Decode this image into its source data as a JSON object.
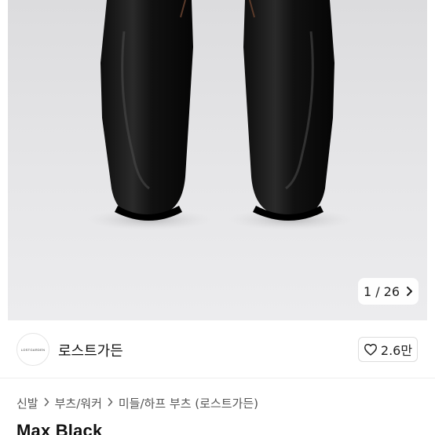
{
  "gallery": {
    "counter": "1 / 26",
    "next_icon": "chevron-right-icon"
  },
  "seller": {
    "logo_text": "LOSTGARDEN",
    "name": "로스트가든",
    "likes": "2.6만",
    "like_icon": "heart-outline-icon"
  },
  "breadcrumb": {
    "items": [
      "신발",
      "부츠/워커",
      "미들/하프 부츠 (로스트가든)"
    ],
    "separator_icon": "chevron-right-icon"
  },
  "product": {
    "title": "Max Black"
  }
}
